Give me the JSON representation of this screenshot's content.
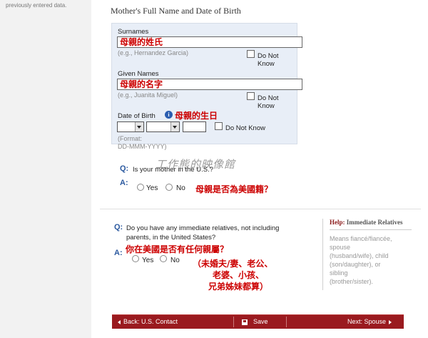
{
  "sidebar": {
    "note": "previously entered data."
  },
  "mother_section": {
    "title": "Mother's Full Name and Date of Birth",
    "surnames": {
      "label": "Surnames",
      "value": "母親的姓氏",
      "hint": "(e.g., Hernandez Garcia)",
      "dnk": "Do Not Know"
    },
    "given": {
      "label": "Given Names",
      "value": "母親的名字",
      "hint": "(e.g., Juanita Miguel)",
      "dnk": "Do Not Know"
    },
    "dob": {
      "label": "Date of Birth",
      "annotation": "母親的生日",
      "dnk": "Do Not Know",
      "format_line1": "(Format:",
      "format_line2": "DD-MMM-YYYY)"
    },
    "question": {
      "q": "Q:",
      "text": "Is your mother in the U.S.?",
      "a": "A:",
      "yes": "Yes",
      "no": "No",
      "annotation": "母親是否為美國籍？"
    }
  },
  "watermark": "工作熊的映像館",
  "relatives": {
    "q": "Q:",
    "text_line1": "Do you have any immediate relatives, not including",
    "text_line2": "parents, in the United States?",
    "a": "A:",
    "annotation_title": "你在美國是否有任何親屬？",
    "yes": "Yes",
    "no": "No",
    "annotation_l1": "（未婚夫/妻、老公、",
    "annotation_l2": "老婆、小孩、",
    "annotation_l3": "兄弟姊妹都算）"
  },
  "help": {
    "prefix": "Help:",
    "title": "Immediate Relatives",
    "l1": "Means fiancé/fiancée,",
    "l2": "spouse",
    "l3": "(husband/wife), child",
    "l4": "(son/daughter), or",
    "l5": "sibling",
    "l6": "(brother/sister)."
  },
  "nav": {
    "back": "Back: U.S. Contact",
    "save": "Save",
    "next": "Next: Spouse"
  }
}
